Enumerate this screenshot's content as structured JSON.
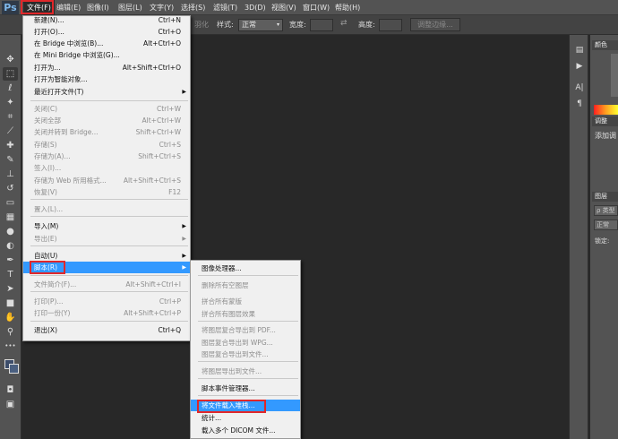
{
  "menubar": {
    "logo": "Ps",
    "items": [
      "文件(F)",
      "编辑(E)",
      "图像(I)",
      "图层(L)",
      "文字(Y)",
      "选择(S)",
      "滤镜(T)",
      "3D(D)",
      "视图(V)",
      "窗口(W)",
      "帮助(H)"
    ]
  },
  "options": {
    "feather_tail": "羽化",
    "style_label": "样式:",
    "style_value": "正常",
    "width_label": "宽度:",
    "height_label": "高度:",
    "refine_edge": "调整边缘..."
  },
  "file_menu": [
    {
      "label": "新建(N)...",
      "shortcut": "Ctrl+N",
      "enabled": true
    },
    {
      "label": "打开(O)...",
      "shortcut": "Ctrl+O",
      "enabled": true
    },
    {
      "label": "在 Bridge 中浏览(B)...",
      "shortcut": "Alt+Ctrl+O",
      "enabled": true
    },
    {
      "label": "在 Mini Bridge 中浏览(G)...",
      "shortcut": "",
      "enabled": true
    },
    {
      "label": "打开为...",
      "shortcut": "Alt+Shift+Ctrl+O",
      "enabled": true
    },
    {
      "label": "打开为智能对象...",
      "shortcut": "",
      "enabled": true
    },
    {
      "label": "最近打开文件(T)",
      "shortcut": "",
      "enabled": true,
      "submenu": true
    },
    {
      "label": "关闭(C)",
      "shortcut": "Ctrl+W",
      "enabled": false
    },
    {
      "label": "关闭全部",
      "shortcut": "Alt+Ctrl+W",
      "enabled": false
    },
    {
      "label": "关闭并转到 Bridge...",
      "shortcut": "Shift+Ctrl+W",
      "enabled": false
    },
    {
      "label": "存储(S)",
      "shortcut": "Ctrl+S",
      "enabled": false
    },
    {
      "label": "存储为(A)...",
      "shortcut": "Shift+Ctrl+S",
      "enabled": false
    },
    {
      "label": "签入(I)...",
      "shortcut": "",
      "enabled": false
    },
    {
      "label": "存储为 Web 所用格式...",
      "shortcut": "Alt+Shift+Ctrl+S",
      "enabled": false
    },
    {
      "label": "恢复(V)",
      "shortcut": "F12",
      "enabled": false
    },
    {
      "label": "置入(L)...",
      "shortcut": "",
      "enabled": false
    },
    {
      "label": "导入(M)",
      "shortcut": "",
      "enabled": true,
      "submenu": true
    },
    {
      "label": "导出(E)",
      "shortcut": "",
      "enabled": false,
      "submenu": true
    },
    {
      "label": "自动(U)",
      "shortcut": "",
      "enabled": true,
      "submenu": true
    },
    {
      "label": "脚本(R)",
      "shortcut": "",
      "enabled": true,
      "submenu": true,
      "highlighted": true
    },
    {
      "label": "文件简介(F)...",
      "shortcut": "Alt+Shift+Ctrl+I",
      "enabled": false
    },
    {
      "label": "打印(P)...",
      "shortcut": "Ctrl+P",
      "enabled": false
    },
    {
      "label": "打印一份(Y)",
      "shortcut": "Alt+Shift+Ctrl+P",
      "enabled": false
    },
    {
      "label": "退出(X)",
      "shortcut": "Ctrl+Q",
      "enabled": true
    }
  ],
  "scripts_menu": [
    {
      "label": "图像处理器...",
      "enabled": true
    },
    {
      "label": "删除所有空图层",
      "enabled": false
    },
    {
      "label": "拼合所有蒙版",
      "enabled": false
    },
    {
      "label": "拼合所有图层效果",
      "enabled": false
    },
    {
      "label": "将图层复合导出到 PDF...",
      "enabled": false
    },
    {
      "label": "图层复合导出到 WPG...",
      "enabled": false
    },
    {
      "label": "图层复合导出到文件...",
      "enabled": false
    },
    {
      "label": "将图层导出到文件...",
      "enabled": false
    },
    {
      "label": "脚本事件管理器...",
      "enabled": true
    },
    {
      "label": "将文件载入堆栈...",
      "enabled": true,
      "highlighted": true
    },
    {
      "label": "统计...",
      "enabled": true
    },
    {
      "label": "载入多个 DICOM 文件...",
      "enabled": true
    }
  ],
  "panels": {
    "color_tab": "颜色",
    "adjust_tab": "调整",
    "adjust_text": "添加调",
    "layers_tab": "图层",
    "layers_kind": "ρ 类型",
    "layers_blend": "正常",
    "layers_lock": "锁定:"
  },
  "colors": {
    "highlight": "#3399ff",
    "annotation_red": "#e0272a",
    "workspace": "#282828"
  }
}
